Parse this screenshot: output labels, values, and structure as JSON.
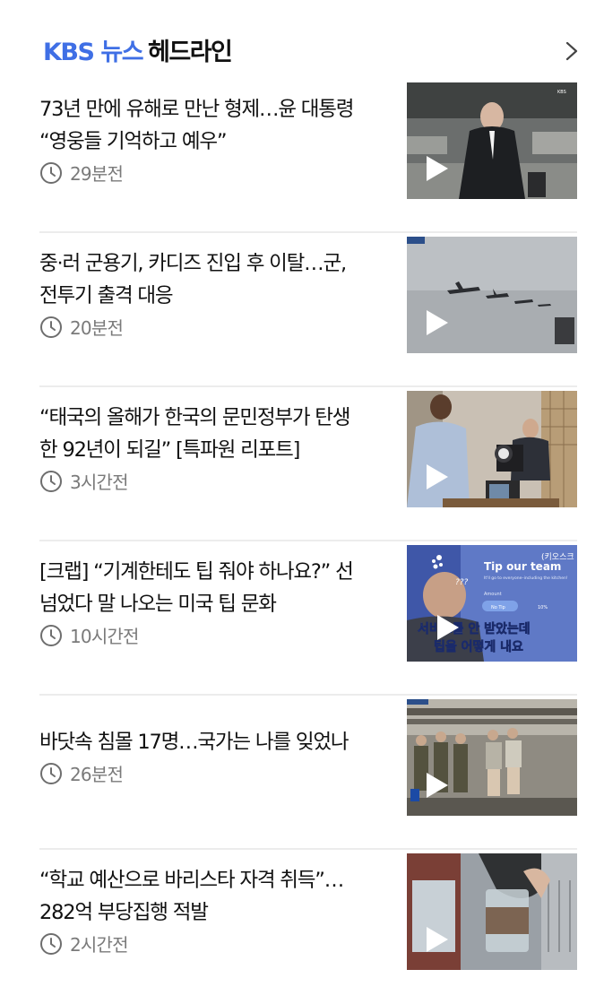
{
  "header": {
    "brand": "KBS 뉴스",
    "title": "헤드라인",
    "more_icon": "chevron-right-icon"
  },
  "colors": {
    "brand": "#3f6fe5",
    "text": "#111111",
    "meta": "#7a7a7a",
    "divider": "#ececec"
  },
  "items": [
    {
      "headline_lines": [
        "73년 만에 유해로 만난 형제…윤 대통령",
        "“영웅들 기억하고 예우”"
      ],
      "time": "29분전"
    },
    {
      "headline_lines": [
        "중·러 군용기, 카디즈 진입 후 이탈…군,",
        "전투기 출격 대응"
      ],
      "time": "20분전"
    },
    {
      "headline_lines": [
        "“태국의 올해가 한국의 문민정부가 탄생",
        "한 92년이 되길” [특파원 리포트]"
      ],
      "time": "3시간전"
    },
    {
      "headline_lines": [
        "[크랩] “기계한테도 팁 줘야 하나요?” 선",
        "넘었다 말 나오는 미국 팁 문화"
      ],
      "time": "10시간전",
      "thumb_text": {
        "a": "Tip our team",
        "b": "(키오스크",
        "c": "It'll go to everyone–including the kitchen!",
        "d": "Amount",
        "e": "No Tip",
        "f": "10%",
        "g": "???",
        "h": "서비스를 안 받았는데",
        "i": "팁을 어떻게 내요"
      }
    },
    {
      "headline_lines": [
        "바닷속 침몰 17명…국가는 나를 잊었나"
      ],
      "time": "26분전"
    },
    {
      "headline_lines": [
        "“학교 예산으로 바리스타 자격 취득”…",
        "282억 부당집행 적발"
      ],
      "time": "2시간전"
    }
  ]
}
